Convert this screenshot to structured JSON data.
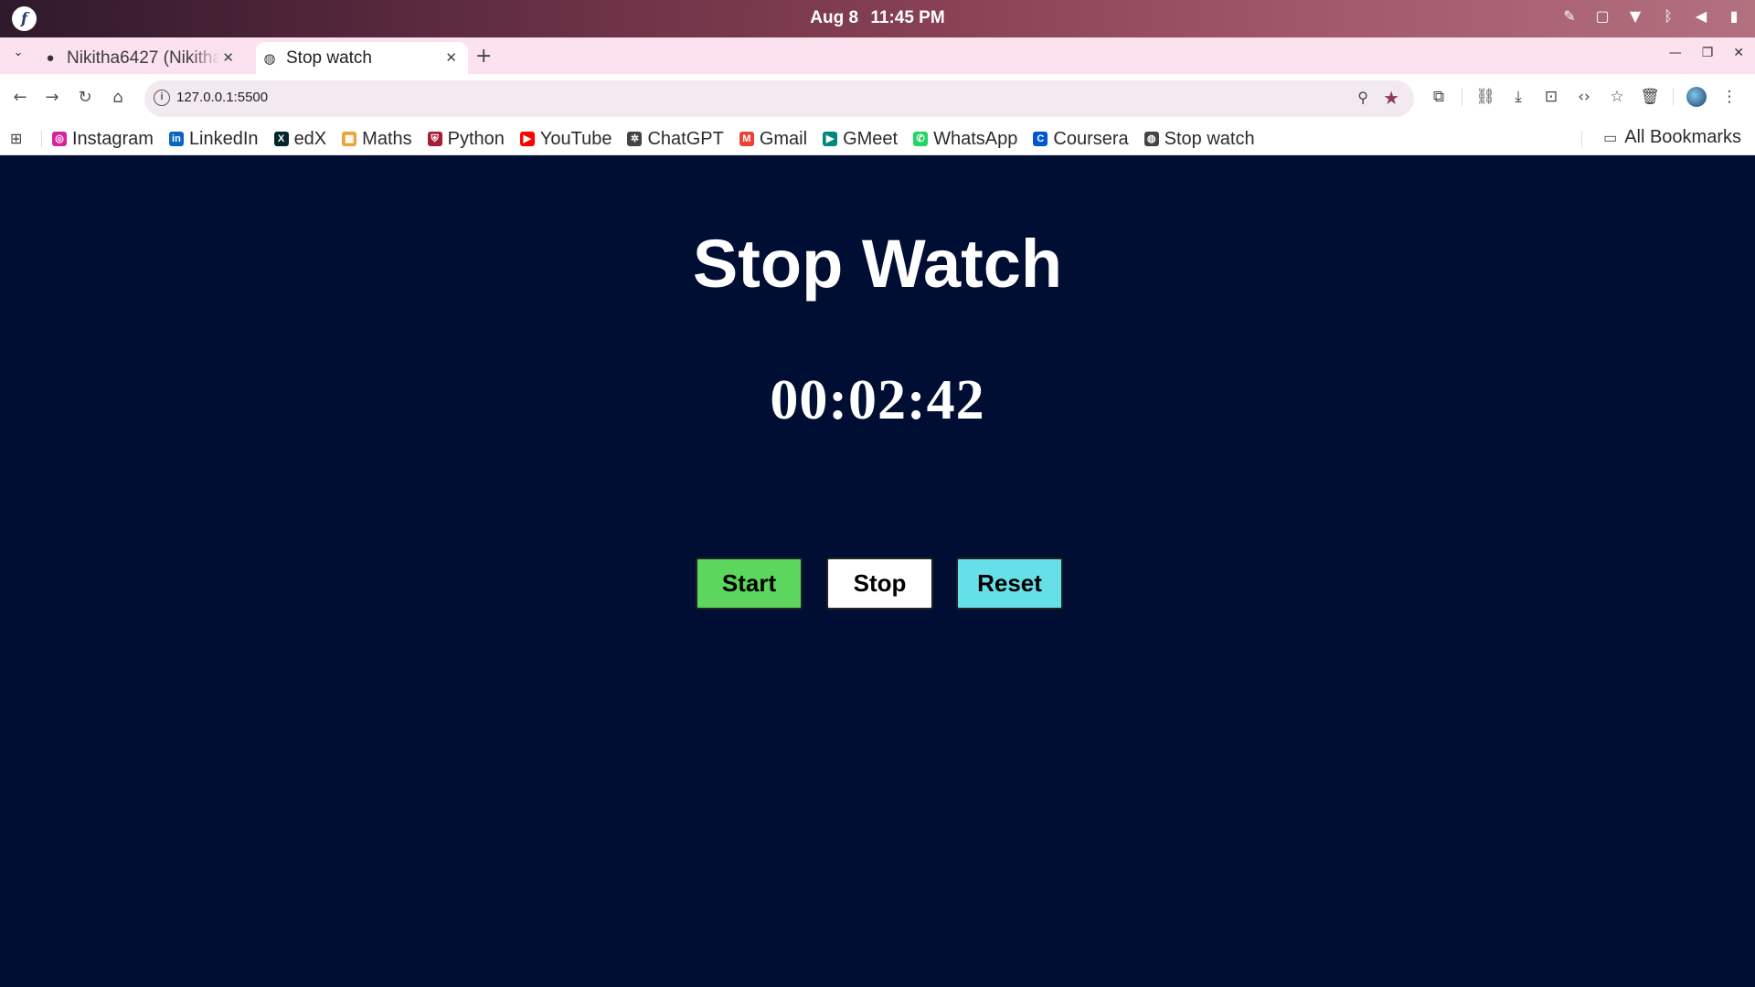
{
  "os": {
    "date": "Aug 8",
    "time": "11:45 PM",
    "logo": "fedora-logo"
  },
  "tabs": [
    {
      "title": "Nikitha6427 (Nikitha)",
      "icon": "github-icon",
      "active": false
    },
    {
      "title": "Stop watch",
      "icon": "globe-icon",
      "active": true
    }
  ],
  "address_bar": {
    "url": "127.0.0.1:5500"
  },
  "bookmarks": [
    {
      "label": "Instagram",
      "icon": "instagram-icon",
      "color": "#d6249f"
    },
    {
      "label": "LinkedIn",
      "icon": "linkedin-icon",
      "color": "#0a66c2"
    },
    {
      "label": "edX",
      "icon": "edx-icon",
      "color": "#02262b"
    },
    {
      "label": "Maths",
      "icon": "maths-icon",
      "color": "#e8a33b"
    },
    {
      "label": "Python",
      "icon": "python-shield-icon",
      "color": "#a31f34"
    },
    {
      "label": "YouTube",
      "icon": "youtube-icon",
      "color": "#ff0000"
    },
    {
      "label": "ChatGPT",
      "icon": "chatgpt-icon",
      "color": "#444444"
    },
    {
      "label": "Gmail",
      "icon": "gmail-icon",
      "color": "#ea4335"
    },
    {
      "label": "GMeet",
      "icon": "gmeet-icon",
      "color": "#00897b"
    },
    {
      "label": "WhatsApp",
      "icon": "whatsapp-icon",
      "color": "#25d366"
    },
    {
      "label": "Coursera",
      "icon": "coursera-icon",
      "color": "#0056d2"
    },
    {
      "label": "Stop watch",
      "icon": "globe-icon",
      "color": "#444444"
    }
  ],
  "all_bookmarks_label": "All Bookmarks",
  "page": {
    "title": "Stop Watch",
    "time_display": "00:02:42",
    "buttons": {
      "start": "Start",
      "stop": "Stop",
      "reset": "Reset"
    }
  },
  "colors": {
    "page_background": "#000e33",
    "start_button": "#5cd65c",
    "stop_button": "#ffffff",
    "reset_button": "#66e0e8"
  }
}
